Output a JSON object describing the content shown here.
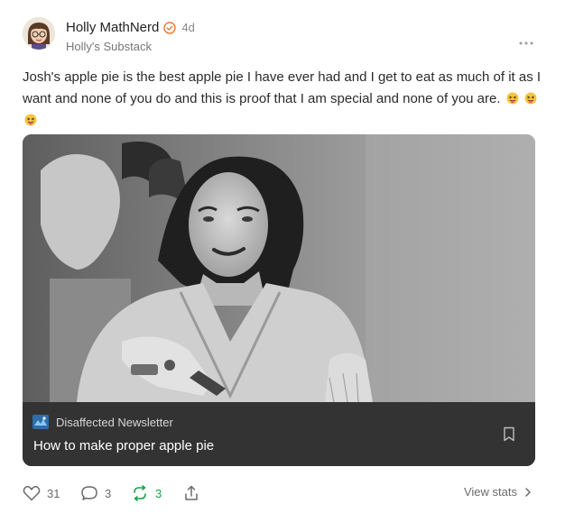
{
  "post": {
    "author": "Holly MathNerd",
    "time": "4d",
    "publication": "Holly's Substack",
    "text": "Josh's apple pie is the best apple pie I have ever had and I get to eat as much of it as I want and none of you do and this is proof that I am special and none of you are.",
    "emoji": "squinting-face-with-tongue",
    "verified_color": "#e8772e"
  },
  "card": {
    "publication": "Disaffected Newsletter",
    "title": "How to make proper apple pie"
  },
  "actions": {
    "likes": "31",
    "comments": "3",
    "restacks": "3",
    "restack_color": "#19a34a",
    "view_stats": "View stats"
  }
}
